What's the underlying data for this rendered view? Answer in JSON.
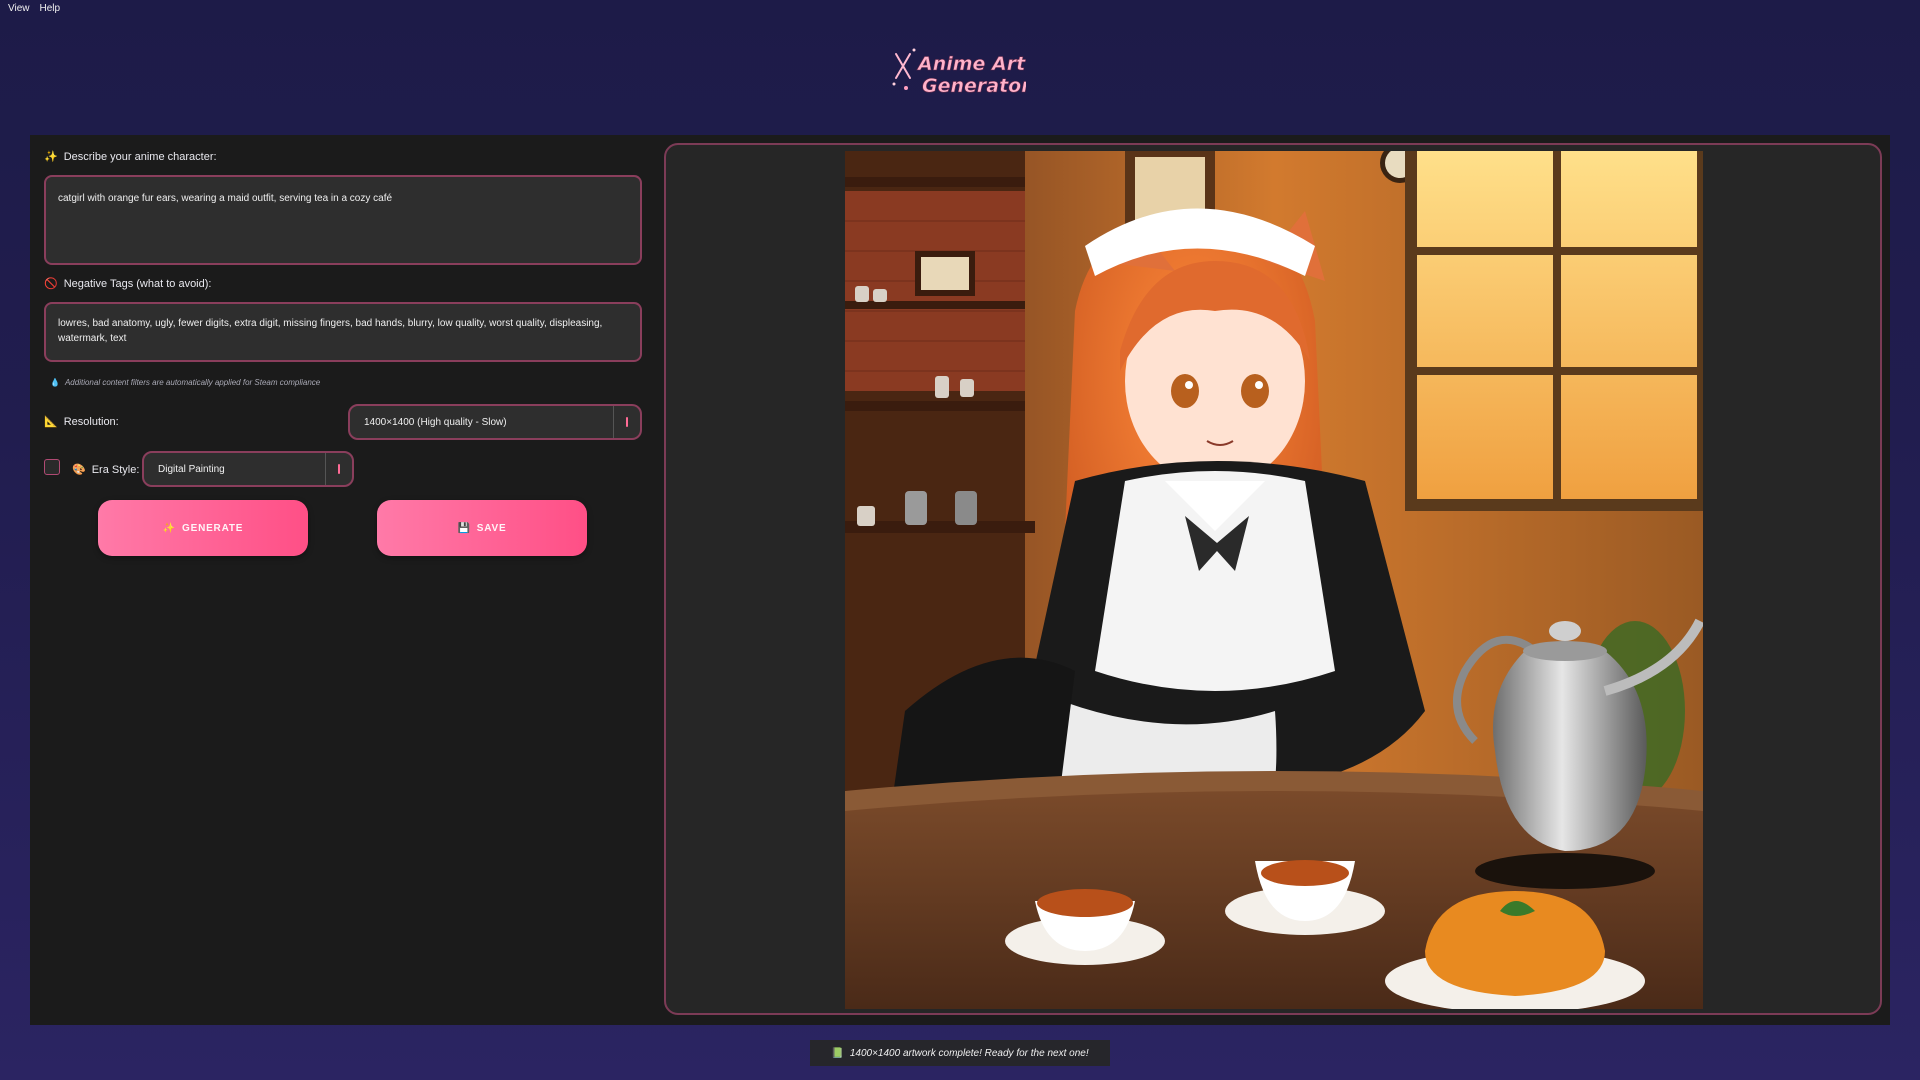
{
  "menu": {
    "view": "View",
    "help": "Help"
  },
  "logo": {
    "line1": "Anime Art",
    "line2": "Generator"
  },
  "describe": {
    "label": "Describe your anime character:",
    "icon": "sparkles-icon",
    "value": "catgirl with orange fur ears, wearing a maid outfit, serving tea in a cozy café"
  },
  "negative": {
    "label": "Negative Tags (what to avoid):",
    "icon": "no-entry-icon",
    "value": "lowres, bad anatomy, ugly, fewer digits, extra digit, missing fingers, bad hands, blurry, low quality, worst quality, displeasing, watermark, text"
  },
  "note": "Additional content filters are automatically applied for Steam compliance",
  "resolution": {
    "label": "Resolution:",
    "icon": "triangle-ruler-icon",
    "selected": "1400×1400 (High quality - Slow)"
  },
  "era": {
    "label": "Era Style:",
    "icon": "palette-icon",
    "selected": "Digital Painting",
    "checked": false
  },
  "buttons": {
    "generate": "GENERATE",
    "save": "SAVE"
  },
  "status": "1400×1400 artwork complete! Ready for the next one!",
  "colors": {
    "accent": "#ff5c8e",
    "border": "#8a3e5c",
    "panel": "#1b1b1b"
  }
}
